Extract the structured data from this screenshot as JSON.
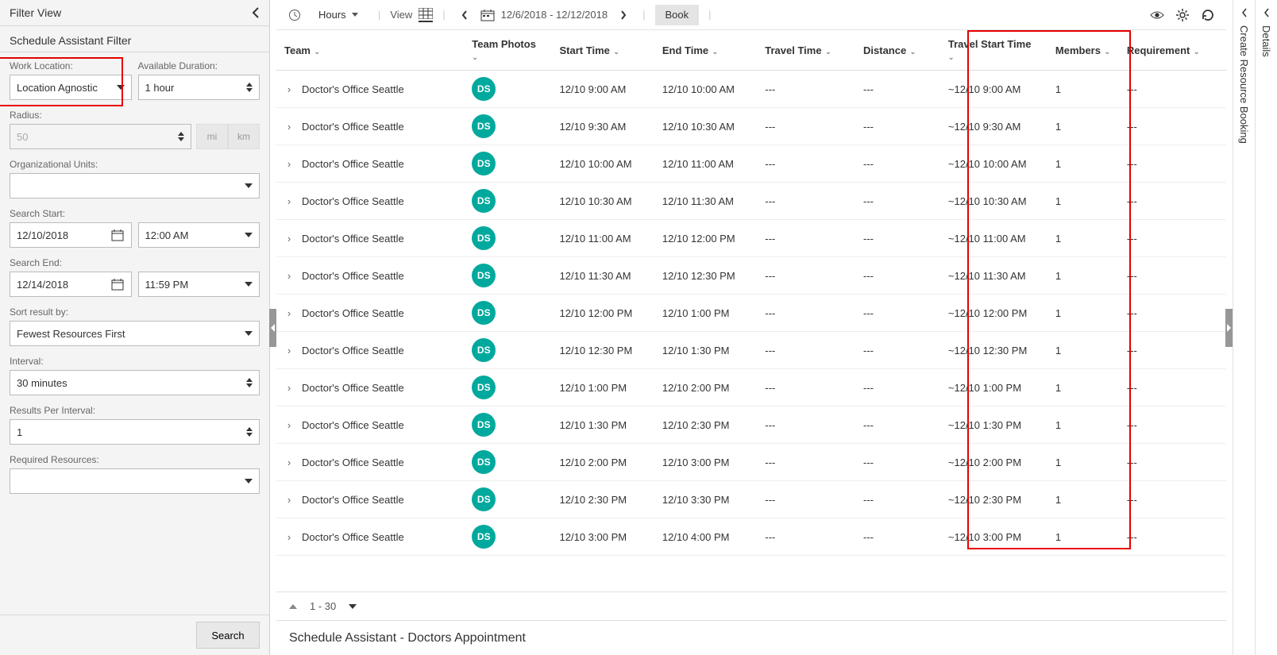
{
  "filter": {
    "header": "Filter View",
    "sub_header": "Schedule Assistant Filter",
    "work_location_label": "Work Location:",
    "work_location_value": "Location Agnostic",
    "avail_duration_label": "Available Duration:",
    "avail_duration_value": "1 hour",
    "radius_label": "Radius:",
    "radius_value": "50",
    "unit_mi": "mi",
    "unit_km": "km",
    "org_units_label": "Organizational Units:",
    "org_units_value": "",
    "search_start_label": "Search Start:",
    "search_start_date": "12/10/2018",
    "search_start_time": "12:00 AM",
    "search_end_label": "Search End:",
    "search_end_date": "12/14/2018",
    "search_end_time": "11:59 PM",
    "sort_label": "Sort result by:",
    "sort_value": "Fewest Resources First",
    "interval_label": "Interval:",
    "interval_value": "30 minutes",
    "results_per_label": "Results Per Interval:",
    "results_per_value": "1",
    "required_res_label": "Required Resources:",
    "search_button": "Search"
  },
  "toolbar": {
    "hours": "Hours",
    "view": "View",
    "date_range": "12/6/2018 - 12/12/2018",
    "book": "Book"
  },
  "columns": [
    "Team",
    "Team Photos",
    "Start Time",
    "End Time",
    "Travel Time",
    "Distance",
    "Travel Start Time",
    "Members",
    "Requirement"
  ],
  "rows": [
    {
      "team": "Doctor's Office Seattle",
      "initials": "DS",
      "start": "12/10 9:00 AM",
      "end": "12/10 10:00 AM",
      "travel": "---",
      "distance": "---",
      "tstart": "~12/10 9:00 AM",
      "members": "1",
      "req": "---"
    },
    {
      "team": "Doctor's Office Seattle",
      "initials": "DS",
      "start": "12/10 9:30 AM",
      "end": "12/10 10:30 AM",
      "travel": "---",
      "distance": "---",
      "tstart": "~12/10 9:30 AM",
      "members": "1",
      "req": "---"
    },
    {
      "team": "Doctor's Office Seattle",
      "initials": "DS",
      "start": "12/10 10:00 AM",
      "end": "12/10 11:00 AM",
      "travel": "---",
      "distance": "---",
      "tstart": "~12/10 10:00 AM",
      "members": "1",
      "req": "---"
    },
    {
      "team": "Doctor's Office Seattle",
      "initials": "DS",
      "start": "12/10 10:30 AM",
      "end": "12/10 11:30 AM",
      "travel": "---",
      "distance": "---",
      "tstart": "~12/10 10:30 AM",
      "members": "1",
      "req": "---"
    },
    {
      "team": "Doctor's Office Seattle",
      "initials": "DS",
      "start": "12/10 11:00 AM",
      "end": "12/10 12:00 PM",
      "travel": "---",
      "distance": "---",
      "tstart": "~12/10 11:00 AM",
      "members": "1",
      "req": "---"
    },
    {
      "team": "Doctor's Office Seattle",
      "initials": "DS",
      "start": "12/10 11:30 AM",
      "end": "12/10 12:30 PM",
      "travel": "---",
      "distance": "---",
      "tstart": "~12/10 11:30 AM",
      "members": "1",
      "req": "---"
    },
    {
      "team": "Doctor's Office Seattle",
      "initials": "DS",
      "start": "12/10 12:00 PM",
      "end": "12/10 1:00 PM",
      "travel": "---",
      "distance": "---",
      "tstart": "~12/10 12:00 PM",
      "members": "1",
      "req": "---"
    },
    {
      "team": "Doctor's Office Seattle",
      "initials": "DS",
      "start": "12/10 12:30 PM",
      "end": "12/10 1:30 PM",
      "travel": "---",
      "distance": "---",
      "tstart": "~12/10 12:30 PM",
      "members": "1",
      "req": "---"
    },
    {
      "team": "Doctor's Office Seattle",
      "initials": "DS",
      "start": "12/10 1:00 PM",
      "end": "12/10 2:00 PM",
      "travel": "---",
      "distance": "---",
      "tstart": "~12/10 1:00 PM",
      "members": "1",
      "req": "---"
    },
    {
      "team": "Doctor's Office Seattle",
      "initials": "DS",
      "start": "12/10 1:30 PM",
      "end": "12/10 2:30 PM",
      "travel": "---",
      "distance": "---",
      "tstart": "~12/10 1:30 PM",
      "members": "1",
      "req": "---"
    },
    {
      "team": "Doctor's Office Seattle",
      "initials": "DS",
      "start": "12/10 2:00 PM",
      "end": "12/10 3:00 PM",
      "travel": "---",
      "distance": "---",
      "tstart": "~12/10 2:00 PM",
      "members": "1",
      "req": "---"
    },
    {
      "team": "Doctor's Office Seattle",
      "initials": "DS",
      "start": "12/10 2:30 PM",
      "end": "12/10 3:30 PM",
      "travel": "---",
      "distance": "---",
      "tstart": "~12/10 2:30 PM",
      "members": "1",
      "req": "---"
    },
    {
      "team": "Doctor's Office Seattle",
      "initials": "DS",
      "start": "12/10 3:00 PM",
      "end": "12/10 4:00 PM",
      "travel": "---",
      "distance": "---",
      "tstart": "~12/10 3:00 PM",
      "members": "1",
      "req": "---"
    }
  ],
  "paging": {
    "range": "1 - 30"
  },
  "bottom_bar": "Schedule Assistant - Doctors Appointment",
  "rails": {
    "create": "Create Resource Booking",
    "details": "Details"
  }
}
